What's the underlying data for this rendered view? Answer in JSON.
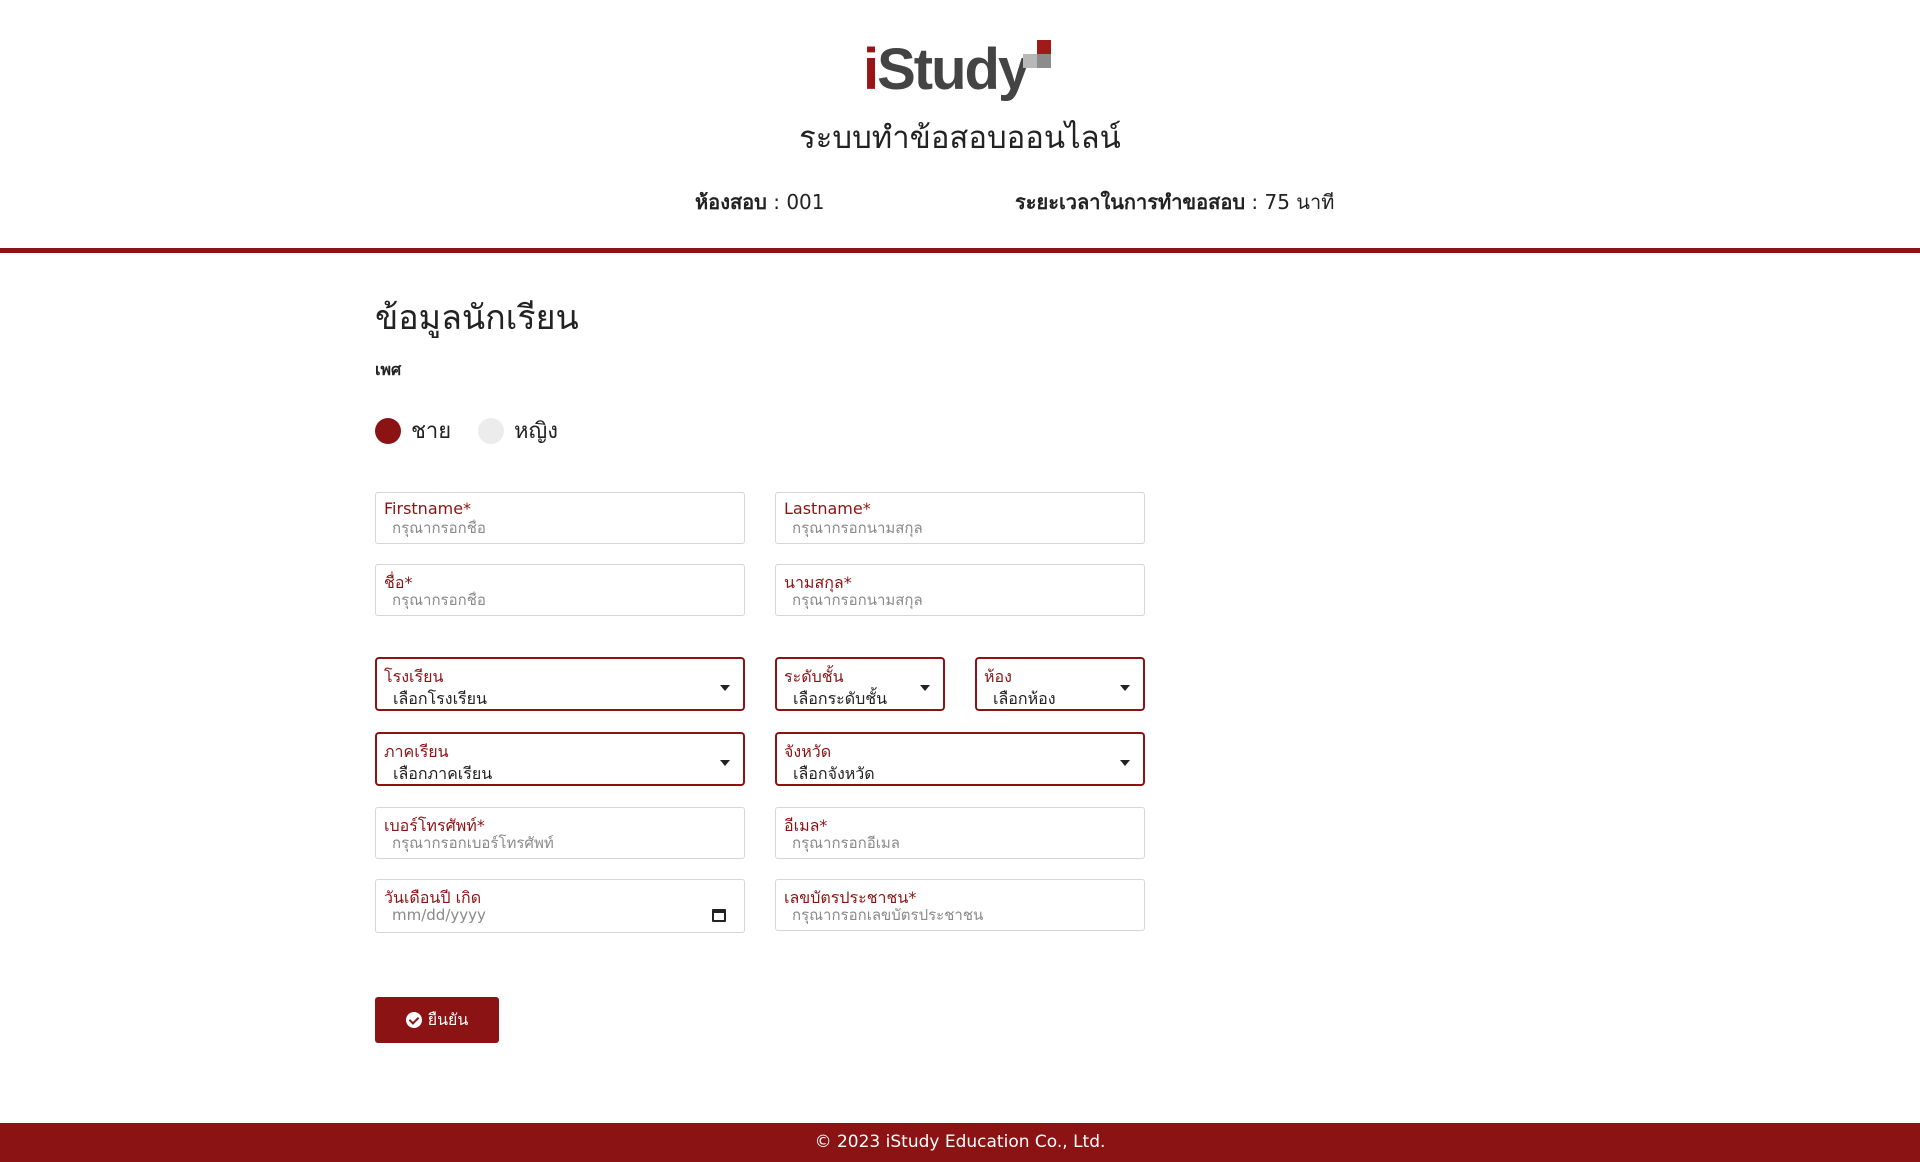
{
  "header": {
    "logo_text_i": "i",
    "logo_text_rest": "Study",
    "system_title": "ระบบทำข้อสอบออนไลน์",
    "room_label": "ห้องสอบ",
    "room_value": ": 001",
    "duration_label": "ระยะเวลาในการทำขอสอบ",
    "duration_value": ": 75 นาที"
  },
  "form": {
    "section_title": "ข้อมูลนักเรียน",
    "gender_label": "เพศ",
    "gender_options": [
      {
        "label": "ชาย",
        "checked": true
      },
      {
        "label": "หญิง",
        "checked": false
      }
    ],
    "firstname": {
      "label": "Firstname*",
      "placeholder": "กรุณากรอกชื่อ"
    },
    "lastname": {
      "label": "Lastname*",
      "placeholder": "กรุณากรอกนามสกุล"
    },
    "name_th": {
      "label": "ชื่อ*",
      "placeholder": "กรุณากรอกชื่อ"
    },
    "surname_th": {
      "label": "นามสกุล*",
      "placeholder": "กรุณากรอกนามสกุล"
    },
    "school": {
      "label": "โรงเรียน",
      "value": "เลือกโรงเรียน"
    },
    "grade": {
      "label": "ระดับชั้น",
      "value": "เลือกระดับชั้น"
    },
    "classroom": {
      "label": "ห้อง",
      "value": "เลือกห้อง"
    },
    "region": {
      "label": "ภาคเรียน",
      "value": "เลือกภาคเรียน"
    },
    "province": {
      "label": "จังหวัด",
      "value": "เลือกจังหวัด"
    },
    "phone": {
      "label": "เบอร์โทรศัพท์*",
      "placeholder": "กรุณากรอกเบอร์โทรศัพท์"
    },
    "email": {
      "label": "อีเมล*",
      "placeholder": "กรุณากรอกอีเมล"
    },
    "birthdate": {
      "label": "วันเดือนปี เกิด",
      "value": "mm/dd/yyyy"
    },
    "id_card": {
      "label": "เลขบัตรประชาชน*",
      "placeholder": "กรุณากรอกเลขบัตรประชาชน"
    },
    "submit_label": "ยืนยัน"
  },
  "footer": {
    "text": "© 2023 iStudy Education Co., Ltd."
  },
  "colors": {
    "accent": "#8b1313",
    "radio_unchecked": "#ececec",
    "field_border": "#d6d6d6"
  },
  "icons": [
    "check-circle-icon",
    "chevron-down-icon",
    "calendar-icon"
  ]
}
